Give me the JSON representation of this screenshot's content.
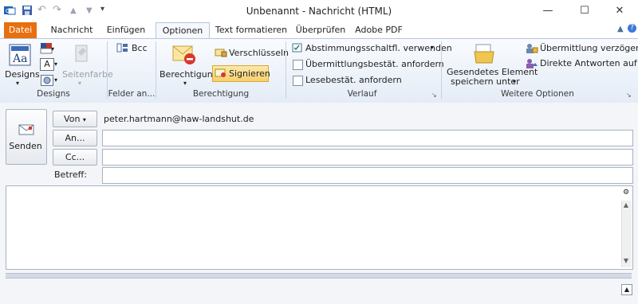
{
  "window": {
    "title": "Unbenannt  -  Nachricht (HTML)"
  },
  "tabs": [
    "Datei",
    "Nachricht",
    "Einfügen",
    "Optionen",
    "Text formatieren",
    "Überprüfen",
    "Adobe PDF"
  ],
  "ribbon": {
    "designs": {
      "button_label": "Designs",
      "page_color": "Seitenfarbe",
      "group": "Designs"
    },
    "fields": {
      "bcc": "Bcc",
      "group": "Felder an..."
    },
    "permission": {
      "big_label": "Berechtigung",
      "encrypt": "Verschlüsseln",
      "sign": "Signieren",
      "group": "Berechtigung"
    },
    "tracking": {
      "voting": "Abstimmungsschaltfl. verwenden",
      "delivery": "Übermittlungsbestät. anfordern",
      "read": "Lesebestät. anfordern",
      "group": "Verlauf"
    },
    "more": {
      "save_sent_line1": "Gesendetes Element",
      "save_sent_line2": "speichern unter",
      "delay": "Übermittlung verzögern",
      "reply_to": "Direkte Antworten auf",
      "group": "Weitere Optionen"
    }
  },
  "form": {
    "send": "Senden",
    "from_button": "Von",
    "from_value": "peter.hartmann@haw-landshut.de",
    "to_button": "An...",
    "cc_button": "Cc...",
    "subject_label": "Betreff:"
  }
}
